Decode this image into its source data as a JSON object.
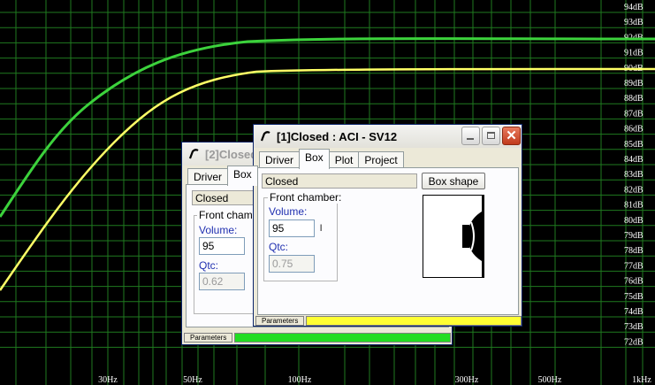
{
  "plot": {
    "y_ticks": [
      "94dB",
      "93dB",
      "92dB",
      "91dB",
      "90dB",
      "89dB",
      "88dB",
      "87dB",
      "86dB",
      "85dB",
      "84dB",
      "83dB",
      "82dB",
      "81dB",
      "80dB",
      "79dB",
      "78dB",
      "77dB",
      "76dB",
      "75dB",
      "74dB",
      "73dB",
      "72dB"
    ],
    "x_ticks": [
      "30Hz",
      "50Hz",
      "100Hz",
      "300Hz",
      "500Hz",
      "1kHz"
    ],
    "series_colors": {
      "green": "#3cd23c",
      "yellow": "#ffff66"
    }
  },
  "window2": {
    "title": "[2]Closed",
    "tabs": [
      "Driver",
      "Box"
    ],
    "box_type": "Closed",
    "group_label": "Front chamber:",
    "volume_label": "Volume:",
    "volume_value": "95",
    "volume_unit": "l",
    "qtc_label": "Qtc:",
    "qtc_value": "0.62",
    "status_label": "Parameters",
    "status_color": "#22dd22"
  },
  "window1": {
    "title": "[1]Closed : ACI - SV12",
    "tabs": [
      "Driver",
      "Box",
      "Plot",
      "Project"
    ],
    "box_type": "Closed",
    "box_shape_button": "Box shape",
    "group_label": "Front chamber:",
    "volume_label": "Volume:",
    "volume_value": "95",
    "volume_unit": "l",
    "qtc_label": "Qtc:",
    "qtc_value": "0.75",
    "status_label": "Parameters",
    "status_color": "#ffff33"
  }
}
